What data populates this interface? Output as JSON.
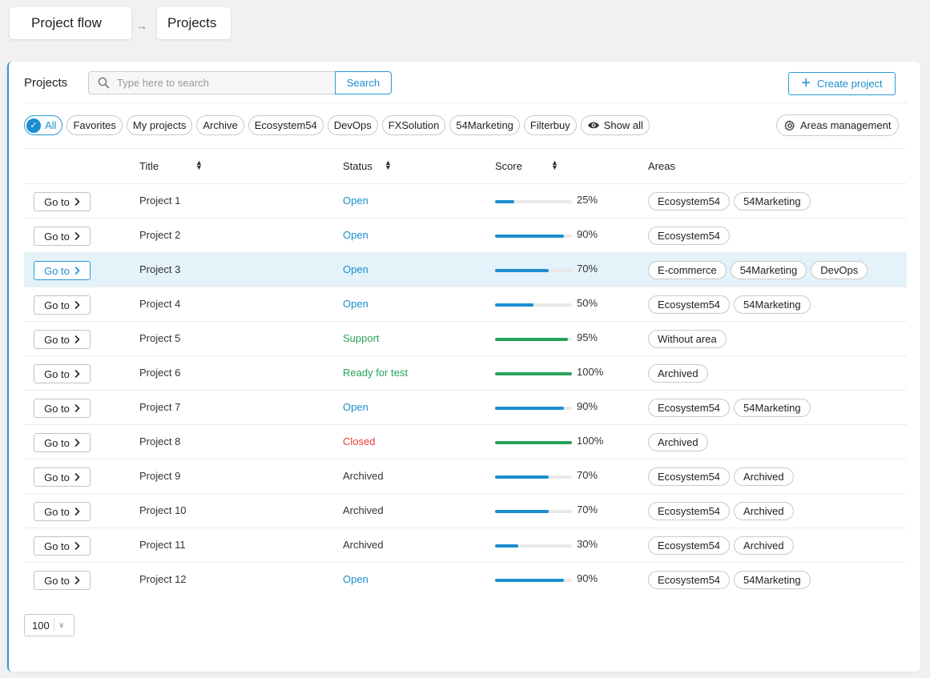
{
  "breadcrumb": {
    "root": "Project flow",
    "arrow": "→",
    "current": "Projects"
  },
  "panel": {
    "title": "Projects",
    "search_placeholder": "Type here to search",
    "search_button": "Search",
    "create_button": "Create project",
    "areas_management": "Areas management"
  },
  "filters": [
    "All",
    "Favorites",
    "My projects",
    "Archive",
    "Ecosystem54",
    "DevOps",
    "FXSolution",
    "54Marketing",
    "Filterbuy",
    "Show all"
  ],
  "columns": {
    "title": "Title",
    "status": "Status",
    "score": "Score",
    "areas": "Areas"
  },
  "goto_label": "Go to",
  "rows": [
    {
      "title": "Project 1",
      "status": "Open",
      "status_type": "open",
      "score": "25%",
      "score_value": 25,
      "bar_color": "blue",
      "areas": [
        "Ecosystem54",
        "54Marketing"
      ]
    },
    {
      "title": "Project 2",
      "status": "Open",
      "status_type": "open",
      "score": "90%",
      "score_value": 90,
      "bar_color": "blue",
      "areas": [
        "Ecosystem54"
      ]
    },
    {
      "title": "Project 3",
      "status": "Open",
      "status_type": "open",
      "score": "70%",
      "score_value": 70,
      "bar_color": "blue",
      "areas": [
        "E-commerce",
        "54Marketing",
        "DevOps"
      ],
      "highlighted": true
    },
    {
      "title": "Project 4",
      "status": "Open",
      "status_type": "open",
      "score": "50%",
      "score_value": 50,
      "bar_color": "blue",
      "areas": [
        "Ecosystem54",
        "54Marketing"
      ]
    },
    {
      "title": "Project 5",
      "status": "Support",
      "status_type": "support",
      "score": "95%",
      "score_value": 95,
      "bar_color": "green",
      "areas": [
        "Without area"
      ]
    },
    {
      "title": "Project 6",
      "status": "Ready for test",
      "status_type": "support",
      "score": "100%",
      "score_value": 100,
      "bar_color": "green",
      "areas": [
        "Archived"
      ]
    },
    {
      "title": "Project 7",
      "status": "Open",
      "status_type": "open",
      "score": "90%",
      "score_value": 90,
      "bar_color": "blue",
      "areas": [
        "Ecosystem54",
        "54Marketing"
      ]
    },
    {
      "title": "Project 8",
      "status": "Closed",
      "status_type": "closed",
      "score": "100%",
      "score_value": 100,
      "bar_color": "green",
      "areas": [
        "Archived"
      ]
    },
    {
      "title": "Project 9",
      "status": "Archived",
      "status_type": "arch",
      "score": "70%",
      "score_value": 70,
      "bar_color": "blue",
      "areas": [
        "Ecosystem54",
        "Archived"
      ]
    },
    {
      "title": "Project 10",
      "status": "Archived",
      "status_type": "arch",
      "score": "70%",
      "score_value": 70,
      "bar_color": "blue",
      "areas": [
        "Ecosystem54",
        "Archived"
      ]
    },
    {
      "title": "Project 11",
      "status": "Archived",
      "status_type": "arch",
      "score": "30%",
      "score_value": 30,
      "bar_color": "blue",
      "areas": [
        "Ecosystem54",
        "Archived"
      ]
    },
    {
      "title": "Project 12",
      "status": "Open",
      "status_type": "open",
      "score": "90%",
      "score_value": 90,
      "bar_color": "blue",
      "areas": [
        "Ecosystem54",
        "54Marketing"
      ]
    }
  ],
  "page_size": "100",
  "colors": {
    "accent": "#1b8ed0",
    "success": "#27a35a",
    "danger": "#e53935",
    "highlight": "#e4f2fa"
  }
}
